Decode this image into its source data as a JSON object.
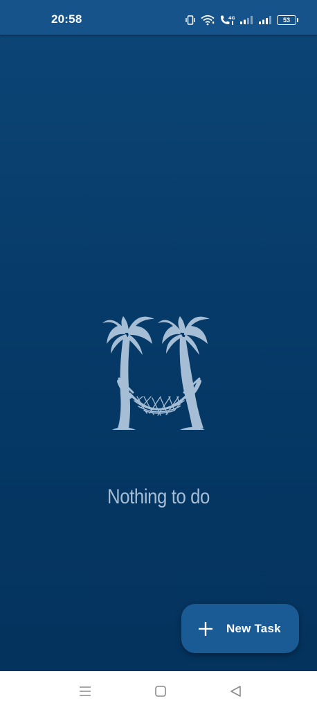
{
  "status_bar": {
    "time": "20:58",
    "battery": "53",
    "icons": [
      "vibrate-icon",
      "wifi-icon",
      "volte-call-icon",
      "signal-icon",
      "signal-icon",
      "battery-icon"
    ]
  },
  "empty_state": {
    "illustration": "palm-trees-hammock",
    "message": "Nothing to do"
  },
  "fab": {
    "icon": "plus-icon",
    "label": "New Task"
  },
  "nav_bar": {
    "buttons": [
      "menu-icon",
      "home-icon",
      "back-icon"
    ]
  },
  "colors": {
    "background_top": "#0c4677",
    "background_bottom": "#04325c",
    "status_bar": "#16538a",
    "fab": "#1a5a95",
    "illustration": "#a6bed5"
  }
}
